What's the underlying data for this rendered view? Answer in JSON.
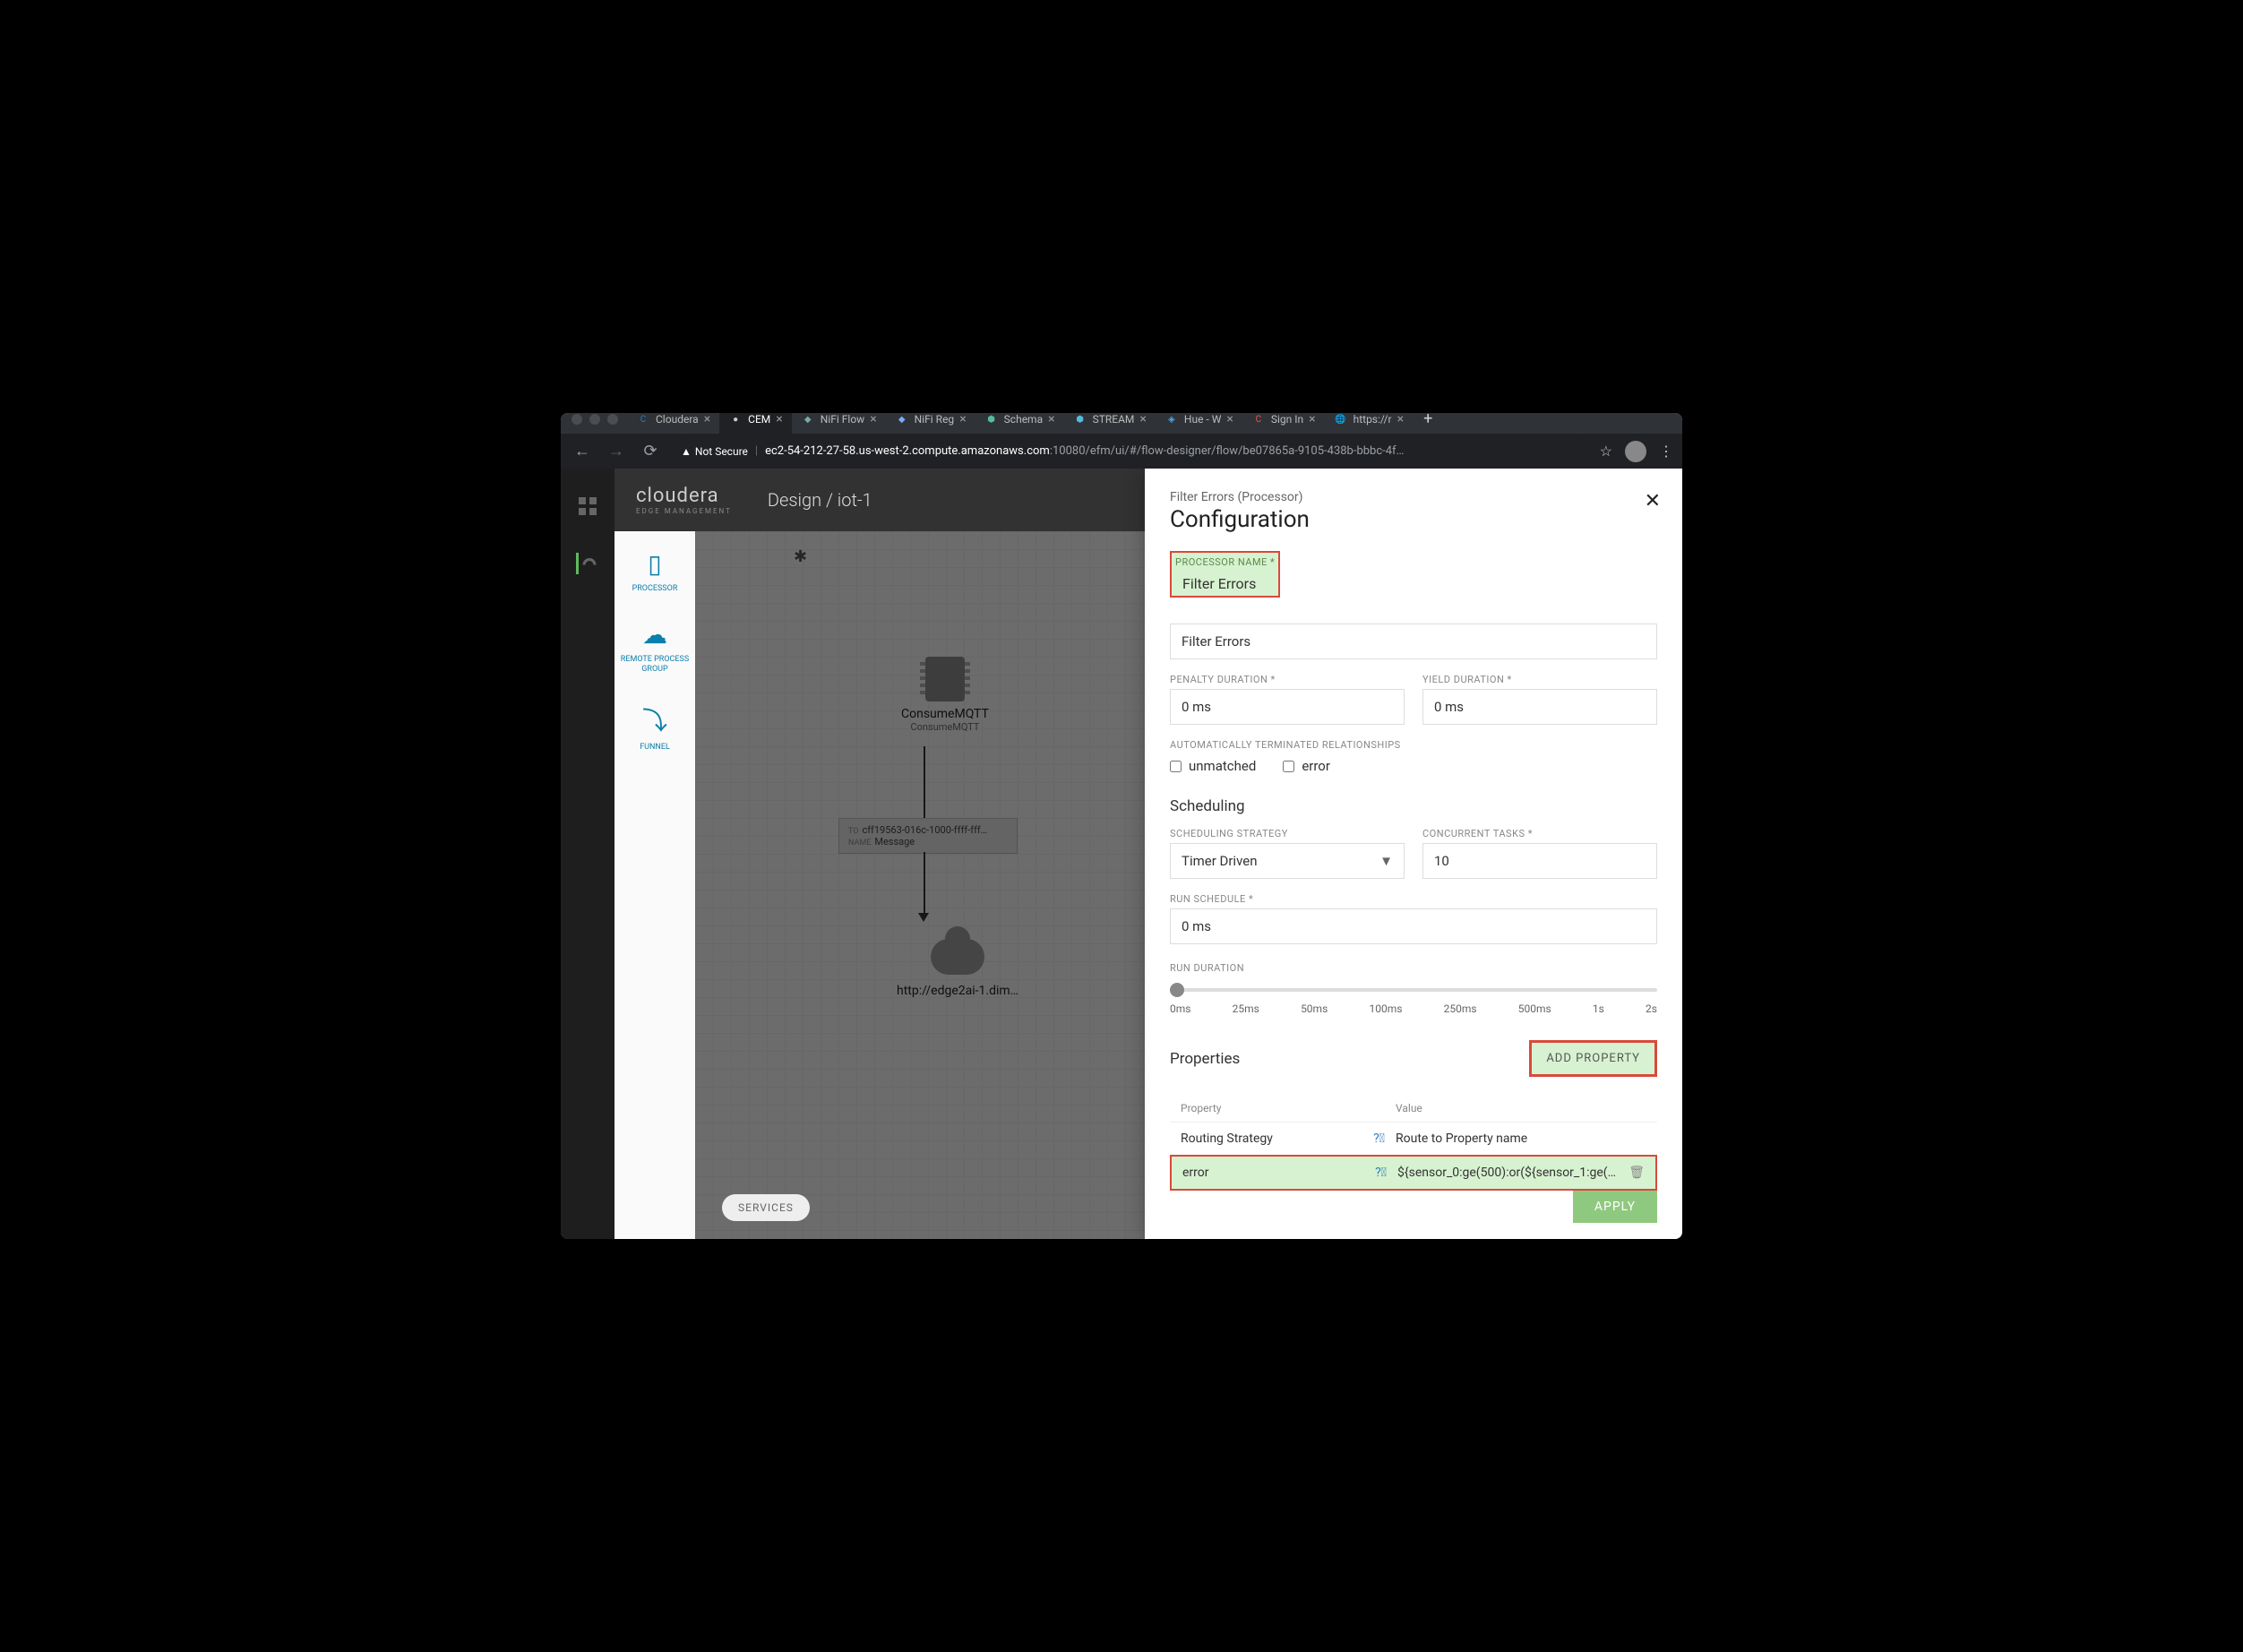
{
  "browser": {
    "tabs": [
      {
        "label": "Cloudera",
        "favicon": "C",
        "fcolor": "#2b7bbd"
      },
      {
        "label": "CEM",
        "favicon": "●",
        "active": true
      },
      {
        "label": "NiFi Flow",
        "favicon": "◆",
        "fcolor": "#7aa"
      },
      {
        "label": "NiFi Reg",
        "favicon": "◆",
        "fcolor": "#7af"
      },
      {
        "label": "Schema",
        "favicon": "⬢",
        "fcolor": "#5b9"
      },
      {
        "label": "STREAM",
        "favicon": "⬢",
        "fcolor": "#5bd"
      },
      {
        "label": "Hue - W",
        "favicon": "◈",
        "fcolor": "#4ae"
      },
      {
        "label": "Sign In",
        "favicon": "C",
        "fcolor": "#e55"
      },
      {
        "label": "https://r",
        "favicon": "🌐"
      }
    ],
    "not_secure": "Not Secure",
    "url_host": "ec2-54-212-27-58.us-west-2.compute.amazonaws.com",
    "url_rest": ":10080/efm/ui/#/flow-designer/flow/be07865a-9105-438b-bbbc-4f…"
  },
  "app": {
    "logo": "cloudera",
    "logo_sub": "EDGE MANAGEMENT",
    "breadcrumb": "Design / iot-1",
    "palette": {
      "processor": "PROCESSOR",
      "rpg": "REMOTE PROCESS GROUP",
      "funnel": "FUNNEL"
    },
    "services_btn": "SERVICES",
    "node1": {
      "title": "ConsumeMQTT",
      "sub": "ConsumeMQTT"
    },
    "connection": {
      "to_k": "TO",
      "to": "cff19563-016c-1000-ffff-fff…",
      "name_k": "NAME",
      "name": "Message"
    },
    "node2": {
      "title": "http://edge2ai-1.dim…"
    }
  },
  "panel": {
    "subtitle": "Filter Errors (Processor)",
    "title": "Configuration",
    "labels": {
      "processor_name": "PROCESSOR NAME *",
      "penalty": "PENALTY DURATION *",
      "yield": "YIELD DURATION *",
      "auto_term": "AUTOMATICALLY TERMINATED RELATIONSHIPS",
      "scheduling": "Scheduling",
      "strategy": "SCHEDULING STRATEGY",
      "concurrent": "CONCURRENT TASKS *",
      "run_schedule": "RUN SCHEDULE *",
      "run_duration": "RUN DURATION",
      "properties": "Properties",
      "add_property": "ADD PROPERTY",
      "col_property": "Property",
      "col_value": "Value",
      "apply": "APPLY"
    },
    "values": {
      "processor_name": "Filter Errors",
      "penalty": "0 ms",
      "yield": "0 ms",
      "check_unmatched": "unmatched",
      "check_error": "error",
      "strategy": "Timer Driven",
      "concurrent": "10",
      "run_schedule": "0 ms"
    },
    "duration_ticks": [
      "0ms",
      "25ms",
      "50ms",
      "100ms",
      "250ms",
      "500ms",
      "1s",
      "2s"
    ],
    "properties": [
      {
        "name": "Routing Strategy",
        "value": "Route to Property name",
        "hl": false,
        "trash": false
      },
      {
        "name": "error",
        "value": "${sensor_0:ge(500):or(${sensor_1:ge(…",
        "hl": true,
        "trash": true
      }
    ]
  }
}
